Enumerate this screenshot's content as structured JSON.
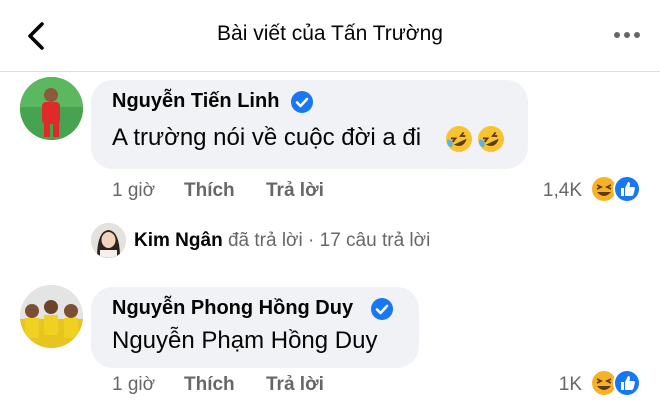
{
  "header": {
    "title": "Bài viết của Tấn Trường",
    "back_icon": "chevron-left-icon",
    "more_icon": "more-horizontal-icon"
  },
  "comments": [
    {
      "author": "Nguyễn Tiến Linh",
      "verified": true,
      "text": "A trường nói về cuộc đời a đi",
      "emojis": [
        "rolling-on-floor-laughing-icon",
        "rolling-on-floor-laughing-icon"
      ],
      "time": "1 giờ",
      "like_label": "Thích",
      "reply_label": "Trả lời",
      "reaction_count": "1,4K",
      "reactions": [
        "haha-icon",
        "like-icon"
      ]
    },
    {
      "author": "Nguyễn Phong Hồng Duy",
      "verified": true,
      "text": "Nguyễn Phạm Hồng Duy",
      "time": "1 giờ",
      "like_label": "Thích",
      "reply_label": "Trả lời",
      "reaction_count": "1K",
      "reactions": [
        "haha-icon",
        "like-icon"
      ]
    }
  ],
  "reply_summary": {
    "name": "Kim Ngân",
    "action": "đã trả lời",
    "separator": "·",
    "count_text": "17 câu trả lời"
  },
  "colors": {
    "bubble": "#f0f2f5",
    "secondary_text": "#65676b",
    "verified_blue": "#1877f2",
    "haha_yellow": "#f7b125"
  }
}
